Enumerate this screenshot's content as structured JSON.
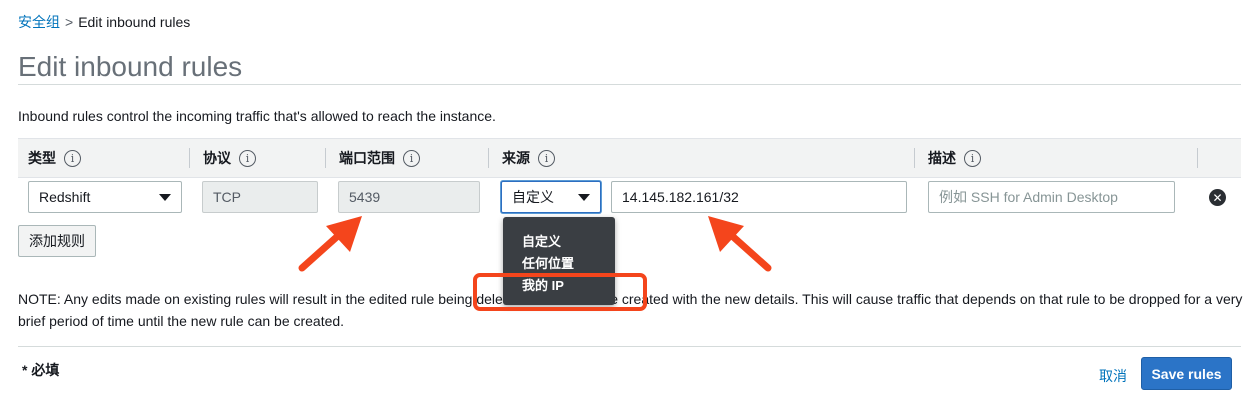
{
  "breadcrumb": {
    "parent": "安全组",
    "separator": ">",
    "current": "Edit inbound rules"
  },
  "page": {
    "title": "Edit inbound rules",
    "description": "Inbound rules control the incoming traffic that's allowed to reach the instance."
  },
  "table": {
    "columns": [
      {
        "label": "类型"
      },
      {
        "label": "协议"
      },
      {
        "label": "端口范围"
      },
      {
        "label": "来源"
      },
      {
        "label": "描述"
      }
    ],
    "info_glyph": "i",
    "row": {
      "type": "Redshift",
      "protocol": "TCP",
      "port_range": "5439",
      "source_mode": "自定义",
      "source_value": "14.145.182.161/32",
      "description_value": "",
      "description_placeholder": "例如 SSH for Admin Desktop",
      "remove_glyph": "✕"
    }
  },
  "dropdown": {
    "options": [
      "自定义",
      "任何位置",
      "我的 IP"
    ],
    "highlighted_option": "我的 IP"
  },
  "buttons": {
    "add_rule": "添加规则",
    "cancel": "取消",
    "save": "Save rules"
  },
  "note": "NOTE: Any edits made on existing rules will result in the edited rule being deleted and a new rule created with the new details. This will cause traffic that depends on that rule to be dropped for a very brief period of time until the new rule can be created.",
  "footer": {
    "required": "* 必填"
  },
  "colors": {
    "link": "#0073bb",
    "primary_button": "#2b74c7",
    "annotation": "#f4451c",
    "dropdown_bg": "#3a3e43"
  },
  "icons": {
    "info": "info-icon",
    "select_caret": "caret-down-icon",
    "remove": "remove-circle-icon",
    "annotation_arrow": "arrow-icon"
  }
}
